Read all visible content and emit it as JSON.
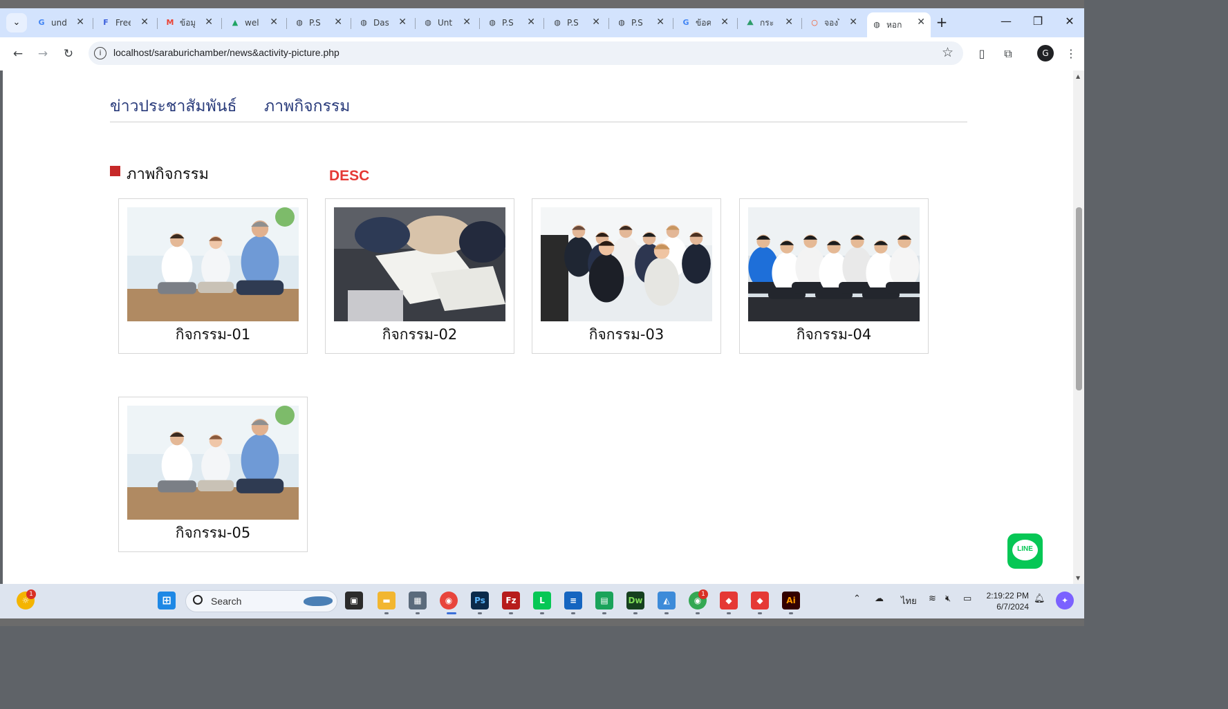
{
  "browser": {
    "tabs": [
      {
        "title": "und",
        "icon": "google-icon",
        "fav": "G",
        "color": "#4285f4"
      },
      {
        "title": "Free",
        "icon": "forms-icon",
        "fav": "F",
        "color": "#3b5fdb"
      },
      {
        "title": "ข้อมู",
        "icon": "gmail-icon",
        "fav": "M",
        "color": "#ea4335"
      },
      {
        "title": "wel",
        "icon": "drive-icon",
        "fav": "▲",
        "color": "#1fa463"
      },
      {
        "title": "P.S",
        "icon": "globe-icon",
        "fav": "◍",
        "color": "#3c4043"
      },
      {
        "title": "Das",
        "icon": "globe-icon",
        "fav": "◍",
        "color": "#3c4043"
      },
      {
        "title": "Unt",
        "icon": "globe-icon",
        "fav": "◍",
        "color": "#3c4043"
      },
      {
        "title": "P.S",
        "icon": "globe-icon",
        "fav": "◍",
        "color": "#3c4043"
      },
      {
        "title": "P.S",
        "icon": "globe-icon",
        "fav": "◍",
        "color": "#3c4043"
      },
      {
        "title": "P.S",
        "icon": "globe-icon",
        "fav": "◍",
        "color": "#3c4043"
      },
      {
        "title": "ข้อค",
        "icon": "google-icon",
        "fav": "G",
        "color": "#4285f4"
      },
      {
        "title": "กระ",
        "icon": "mountain-icon",
        "fav": "⛰",
        "color": "#2e9c6a"
      },
      {
        "title": "จองไ",
        "icon": "ring-icon",
        "fav": "○",
        "color": "#f4511e"
      },
      {
        "title": "หอก",
        "icon": "globe-icon",
        "fav": "◍",
        "color": "#3c4043",
        "active": true
      }
    ],
    "url": "localhost/saraburichamber/news&activity-picture.php"
  },
  "page": {
    "subnav": [
      "ข่าวประชาสัมพันธ์",
      "ภาพกิจกรรม"
    ],
    "section_title": "ภาพกิจกรรม",
    "sort_label": "DESC",
    "activities": [
      {
        "caption": "กิจกรรม-01",
        "photo": "meditation"
      },
      {
        "caption": "กิจกรรม-02",
        "photo": "notes"
      },
      {
        "caption": "กิจกรรม-03",
        "photo": "seminar"
      },
      {
        "caption": "กิจกรรม-04",
        "photo": "applause"
      },
      {
        "caption": "กิจกรรม-05",
        "photo": "meditation"
      }
    ],
    "line_button": "LINE"
  },
  "taskbar": {
    "search_label": "Search",
    "weather_badge": "1",
    "chrome_badge": "1",
    "language": "ไทย",
    "time": "2:19:22 PM",
    "date": "6/7/2024"
  },
  "colors": {
    "accent_red": "#e53935",
    "section_square": "#c62828",
    "nav_blue": "#283a7a",
    "line_green": "#06c755"
  }
}
